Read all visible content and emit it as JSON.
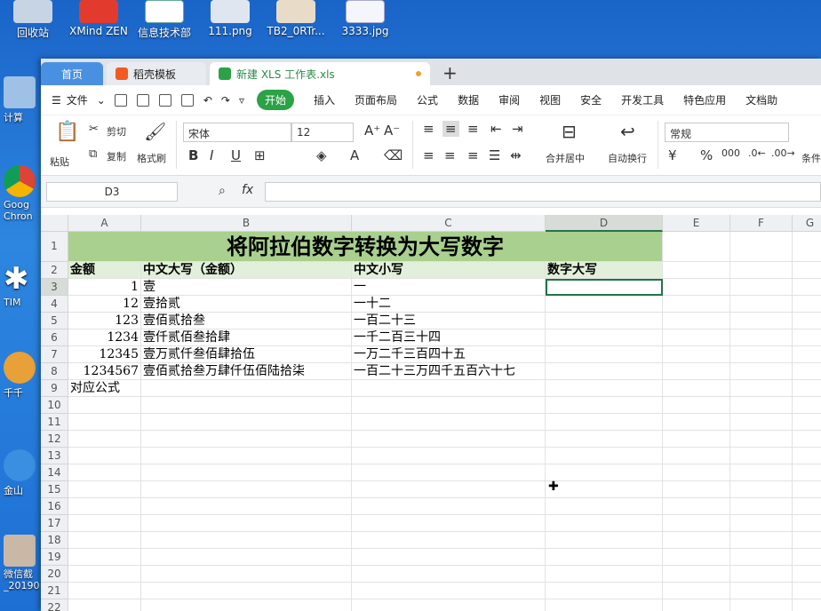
{
  "desktop": {
    "top_icons": [
      "回收站",
      "XMind ZEN",
      "信息技术部",
      "111.png",
      "TB2_0RTr...",
      "3333.jpg"
    ],
    "left_icons": [
      "计算",
      "Goog Chron",
      "TIM",
      "千千",
      "金山",
      "微信截 _20190"
    ]
  },
  "tabs": {
    "home": "首页",
    "daoke": "稻壳模板",
    "file": "新建 XLS 工作表.xls",
    "add": "+"
  },
  "menu": {
    "file": "文件",
    "items": [
      "开始",
      "插入",
      "页面布局",
      "公式",
      "数据",
      "审阅",
      "视图",
      "安全",
      "开发工具",
      "特色应用",
      "文档助"
    ]
  },
  "ribbon": {
    "paste": "粘贴",
    "cut": "剪切",
    "copy": "复制",
    "format_painter": "格式刷",
    "font_name": "宋体",
    "font_size": "12",
    "merge_center": "合并居中",
    "auto_wrap": "自动换行",
    "number_format": "常规",
    "cond_format": "条件"
  },
  "formula_bar": {
    "name_box": "D3",
    "fx": "fx",
    "value": ""
  },
  "sheet": {
    "columns": [
      "A",
      "B",
      "C",
      "D",
      "E",
      "F",
      "G"
    ],
    "rows": [
      "1",
      "2",
      "3",
      "4",
      "5",
      "6",
      "7",
      "8",
      "9",
      "10",
      "11",
      "12",
      "13",
      "14",
      "15",
      "16",
      "17",
      "18",
      "19",
      "20",
      "21",
      "22"
    ],
    "title": "将阿拉伯数字转换为大写数字",
    "headers": [
      "金额",
      "中文大写（金额）",
      "中文小写",
      "数字大写"
    ],
    "data": [
      [
        "1",
        "壹",
        "一"
      ],
      [
        "12",
        "壹拾贰",
        "一十二"
      ],
      [
        "123",
        "壹佰贰拾叁",
        "一百二十三"
      ],
      [
        "1234",
        "壹仟贰佰叁拾肆",
        "一千二百三十四"
      ],
      [
        "12345",
        "壹万贰仟叁佰肆拾伍",
        "一万二千三百四十五"
      ],
      [
        "1234567",
        "壹佰贰拾叁万肆仟伍佰陆拾柒",
        "一百二十三万四千五百六十七"
      ]
    ],
    "row9_label": "对应公式",
    "active_cell": "D3"
  }
}
